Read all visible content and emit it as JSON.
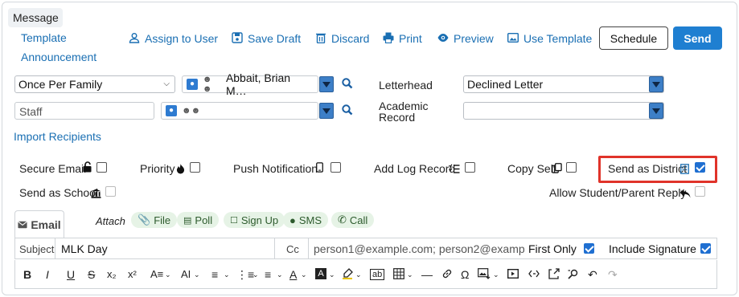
{
  "tabs": {
    "message": "Message"
  },
  "nav": {
    "template": "Template",
    "announcement": "Announcement"
  },
  "toolbar": {
    "assign_to_user": "Assign to User",
    "save_draft": "Save Draft",
    "discard": "Discard",
    "print": "Print",
    "preview": "Preview",
    "use_template": "Use Template",
    "schedule": "Schedule",
    "send": "Send"
  },
  "recipients": {
    "family_select": "Once Per Family",
    "recipient_name": "Abbait, Brian M…",
    "staff_placeholder": "Staff",
    "import_recipients": "Import Recipients"
  },
  "letterhead": {
    "label": "Letterhead",
    "value": "Declined Letter"
  },
  "academic_record": {
    "label_line1": "Academic",
    "label_line2": "Record",
    "value": ""
  },
  "options": {
    "secure_email": "Secure Email",
    "priority": "Priority",
    "push_notification": "Push Notification",
    "add_log_record": "Add Log Record",
    "copy_self": "Copy Self",
    "send_as_district": "Send as District",
    "send_as_school": "Send as School",
    "allow_reply": "Allow Student/Parent Reply"
  },
  "compose_tabs": {
    "email": "Email",
    "attach": "Attach",
    "file": "File",
    "poll": "Poll",
    "sign_up": "Sign Up",
    "sms": "SMS",
    "call": "Call"
  },
  "message_fields": {
    "subject_label": "Subject",
    "subject_value": "MLK Day",
    "cc_label": "Cc",
    "cc_value": "person1@example.com; person2@examp",
    "first_only": "First Only",
    "include_signature": "Include Signature"
  },
  "editor": {
    "bold": "B",
    "italic": "I",
    "underline": "U",
    "strike": "S",
    "subscript": "x₂",
    "superscript": "x²",
    "format": "A≡",
    "font": "AI",
    "text_color": "A",
    "bg_color": "A",
    "special_char": "Ω"
  },
  "colors": {
    "link": "#1a6fb3",
    "send_button": "#1f7fd1",
    "highlight": "#e0332a",
    "checkbox_checked": "#1f6fd1",
    "pill_bg": "#e6f3e6"
  }
}
